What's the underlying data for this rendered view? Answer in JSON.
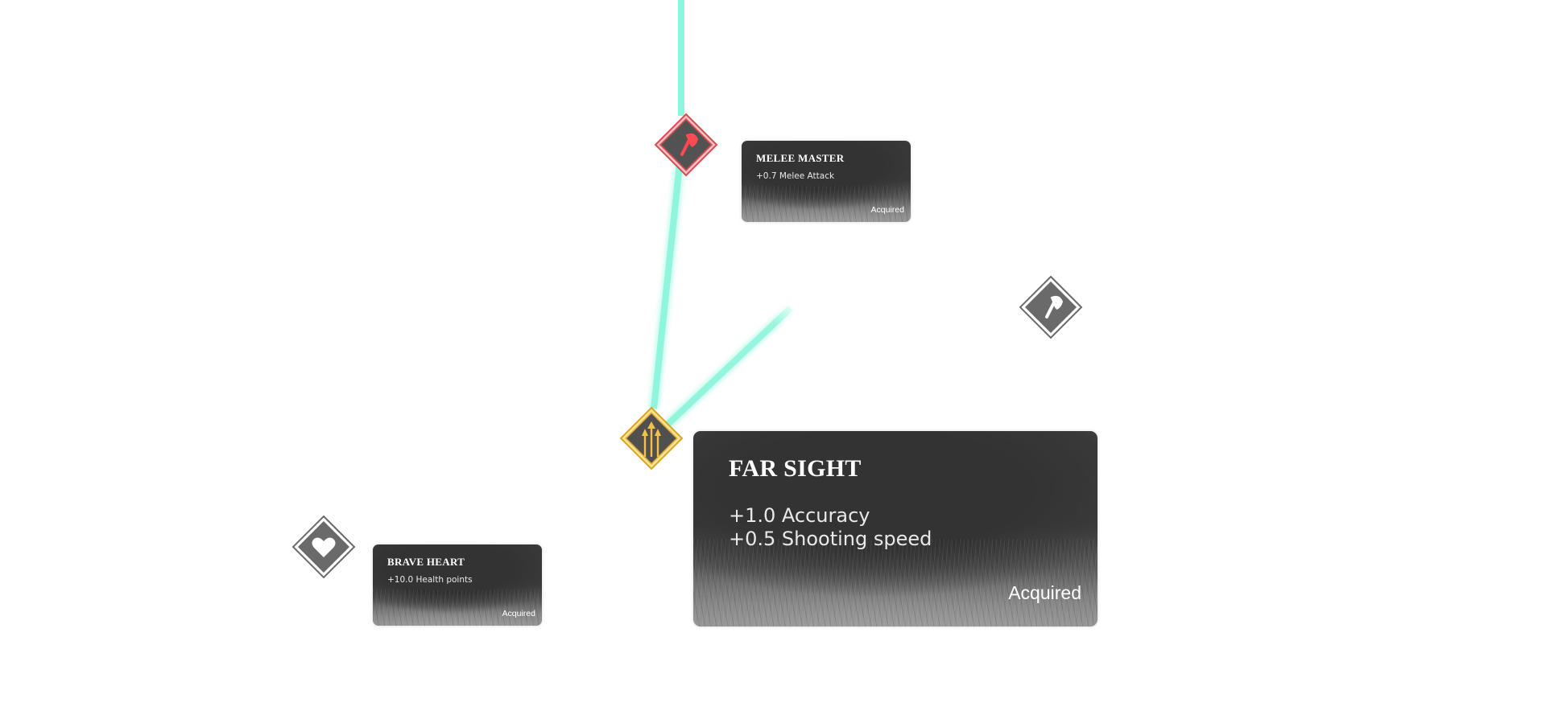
{
  "skills": {
    "melee_master": {
      "title": "MELEE MASTER",
      "stats": [
        "+0.7 Melee Attack"
      ],
      "status": "Acquired",
      "icon": "axe-icon",
      "state": "acquired-melee",
      "color": "#e0484f"
    },
    "far_sight": {
      "title": "FAR SIGHT",
      "stats": [
        "+1.0 Accuracy",
        "+0.5 Shooting speed"
      ],
      "status": "Acquired",
      "icon": "arrows-icon",
      "state": "acquired-selected",
      "color": "#e8b93a"
    },
    "brave_heart": {
      "title": "BRAVE HEART",
      "stats": [
        "+10.0 Health points"
      ],
      "status": "Acquired",
      "icon": "heart-icon",
      "state": "locked",
      "color": "#686868"
    },
    "unnamed_axe": {
      "icon": "axe-icon",
      "state": "locked",
      "color": "#686868"
    }
  },
  "colors": {
    "link": "#8ff5dc",
    "card_bg": "#333333"
  }
}
